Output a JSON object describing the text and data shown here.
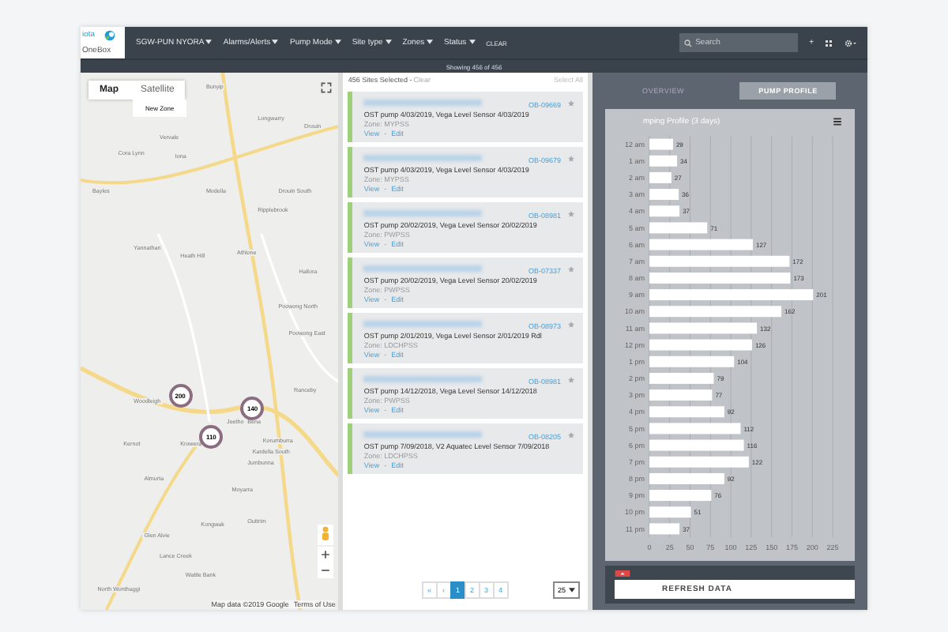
{
  "header": {
    "logo": {
      "top": "iota",
      "bottom": "OneBox"
    },
    "menus": [
      {
        "label": "SGW-PUN NYORA"
      },
      {
        "label": "Alarms/Alerts"
      },
      {
        "label": "Pump Mode"
      },
      {
        "label": "Site type"
      },
      {
        "label": "Zones"
      },
      {
        "label": "Status"
      }
    ],
    "clear": "CLEAR",
    "search": {
      "placeholder": "Search"
    },
    "add": "+"
  },
  "status_text": "Showing 456 of 456",
  "map": {
    "types": [
      {
        "label": "Map",
        "selected": true
      },
      {
        "label": "Satellite",
        "selected": false
      }
    ],
    "new_zone": "New Zone",
    "places": [
      "Bunyip",
      "Longwarry",
      "Drouin",
      "Vervale",
      "Cora Lynn",
      "Iona",
      "Bayles",
      "Modella",
      "Drouin South",
      "Ripplebrook",
      "Yannathan",
      "Heath Hill",
      "Athlone",
      "Hallora",
      "Poowong North",
      "Poowong East",
      "Ranceby",
      "Woodleigh",
      "Jeetho",
      "Bena",
      "Korumburra",
      "Kernot",
      "Krowera",
      "Kardella South",
      "Almurta",
      "Jumbunna",
      "Moyarra",
      "Outtrim",
      "Kongwak",
      "Glen Alvie",
      "Lance Creek",
      "Wattle Bank",
      "North Wonthaggi"
    ],
    "clusters": [
      {
        "count": "200"
      },
      {
        "count": "140"
      },
      {
        "count": "110"
      }
    ],
    "attribution": "Map data ©2019 Google",
    "terms": "Terms of Use"
  },
  "sites": {
    "count_text": "456 Sites Selected -",
    "clear": "Clear",
    "select_all": "Select All",
    "action_separator": "-",
    "items": [
      {
        "id": "OB-09669",
        "description": "OST pump 4/03/2019, Vega Level Sensor 4/03/2019",
        "zone": "Zone: MYPSS",
        "view": "View",
        "edit": "Edit"
      },
      {
        "id": "OB-09679",
        "description": "OST pump 4/03/2019, Vega Level Sensor 4/03/2019",
        "zone": "Zone: MYPSS",
        "view": "View",
        "edit": "Edit"
      },
      {
        "id": "OB-08981",
        "description": "OST pump 20/02/2019, Vega Level Sensor 20/02/2019",
        "zone": "Zone: PWPSS",
        "view": "View",
        "edit": "Edit"
      },
      {
        "id": "OB-07337",
        "description": "OST pump 20/02/2019, Vega Level Sensor 20/02/2019",
        "zone": "Zone: PWPSS",
        "view": "View",
        "edit": "Edit"
      },
      {
        "id": "OB-08973",
        "description": "OST pump 2/01/2019, Vega Level Sensor 2/01/2019 Rdl",
        "zone": "Zone: LDCHPSS",
        "view": "View",
        "edit": "Edit"
      },
      {
        "id": "OB-08981",
        "description": "OST pump 14/12/2018, Vega Level Sensor 14/12/2018",
        "zone": "Zone: PWPSS",
        "view": "View",
        "edit": "Edit"
      },
      {
        "id": "OB-08205",
        "description": "OST pump 7/09/2018, V2 Aquatec Level Sensor 7/09/2018",
        "zone": "Zone: LDCHPSS",
        "view": "View",
        "edit": "Edit"
      }
    ],
    "pagination": {
      "first": "«",
      "prev": "‹",
      "pages": [
        {
          "label": "1",
          "selected": true
        },
        {
          "label": "2",
          "selected": false
        },
        {
          "label": "3",
          "selected": false
        },
        {
          "label": "4",
          "selected": false
        }
      ]
    },
    "page_size": "25"
  },
  "panel": {
    "tabs": [
      {
        "label": "OVERVIEW",
        "selected": false
      },
      {
        "label": "PUMP PROFILE",
        "selected": true
      }
    ],
    "chart_title": "mping Profile (3 days)",
    "chart_data": {
      "type": "bar",
      "orientation": "horizontal",
      "data_labels": true,
      "categories": [
        "12 am",
        "1 am",
        "2 am",
        "3 am",
        "4 am",
        "5 am",
        "6 am",
        "7 am",
        "8 am",
        "9 am",
        "10 am",
        "11 am",
        "12 pm",
        "1 pm",
        "2 pm",
        "3 pm",
        "4 pm",
        "5 pm",
        "6 pm",
        "7 pm",
        "8 pm",
        "9 pm",
        "10 pm",
        "11 pm"
      ],
      "values": [
        29,
        34,
        27,
        36,
        37,
        71,
        127,
        172,
        173,
        201,
        162,
        132,
        126,
        104,
        79,
        77,
        92,
        112,
        116,
        122,
        92,
        76,
        51,
        37
      ],
      "grid": true,
      "xlim": [
        0,
        225
      ],
      "xticks": [
        0,
        25,
        50,
        75,
        100,
        125,
        150,
        175,
        200,
        225
      ]
    },
    "refresh": "REFRESH DATA"
  }
}
